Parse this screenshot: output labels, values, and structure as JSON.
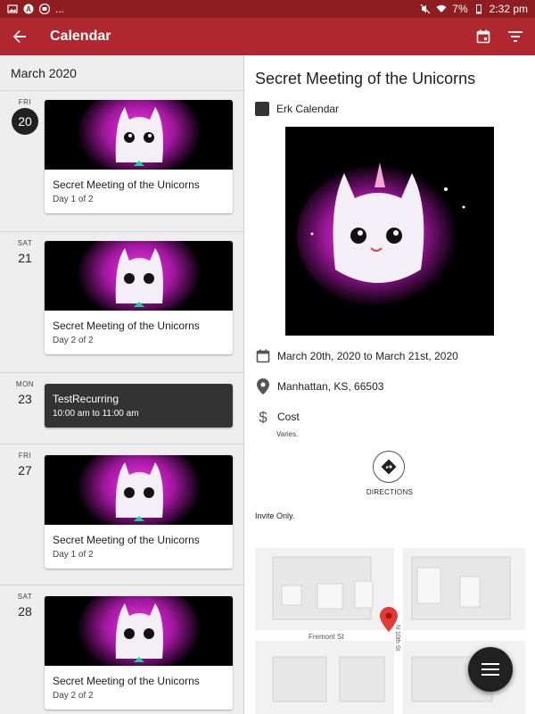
{
  "status_bar": {
    "battery": "7%",
    "time": "2:32 pm",
    "more": "..."
  },
  "app_bar": {
    "title": "Calendar"
  },
  "colors": {
    "app_bar": "#b0272f",
    "status_bar": "#8e1d22",
    "accent_dark": "#212121"
  },
  "icons": {
    "back": "arrow-left-icon",
    "calendar": "calendar-icon",
    "filter": "filter-icon",
    "directions": "directions-icon",
    "location": "location-pin-icon",
    "cost": "dollar-icon",
    "menu": "menu-icon"
  },
  "list": {
    "month": "March 2020",
    "days": [
      {
        "dow": "FRI",
        "day": "20",
        "event_title": "Secret Meeting of the Unicorns",
        "event_sub": "Day 1 of 2"
      },
      {
        "dow": "SAT",
        "day": "21",
        "event_title": "Secret Meeting of the Unicorns",
        "event_sub": "Day 2 of 2"
      },
      {
        "dow": "MON",
        "day": "23",
        "event_title": "TestRecurring",
        "event_sub": "10:00 am to 11:00 am"
      },
      {
        "dow": "FRI",
        "day": "27",
        "event_title": "Secret Meeting of the Unicorns",
        "event_sub": "Day 1 of 2"
      },
      {
        "dow": "SAT",
        "day": "28",
        "event_title": "Secret Meeting of the Unicorns",
        "event_sub": "Day 2 of 2"
      }
    ]
  },
  "detail": {
    "title": "Secret Meeting of the Unicorns",
    "calendar_name": "Erk Calendar",
    "date_range": "March 20th, 2020 to March 21st, 2020",
    "location": "Manhattan, KS, 66503",
    "cost_label": "Cost",
    "cost_value": "Varies.",
    "directions_label": "DIRECTIONS",
    "invite_text": "Invite Only.",
    "map": {
      "street_1": "Fremont St",
      "street_2": "N 10th St"
    }
  }
}
